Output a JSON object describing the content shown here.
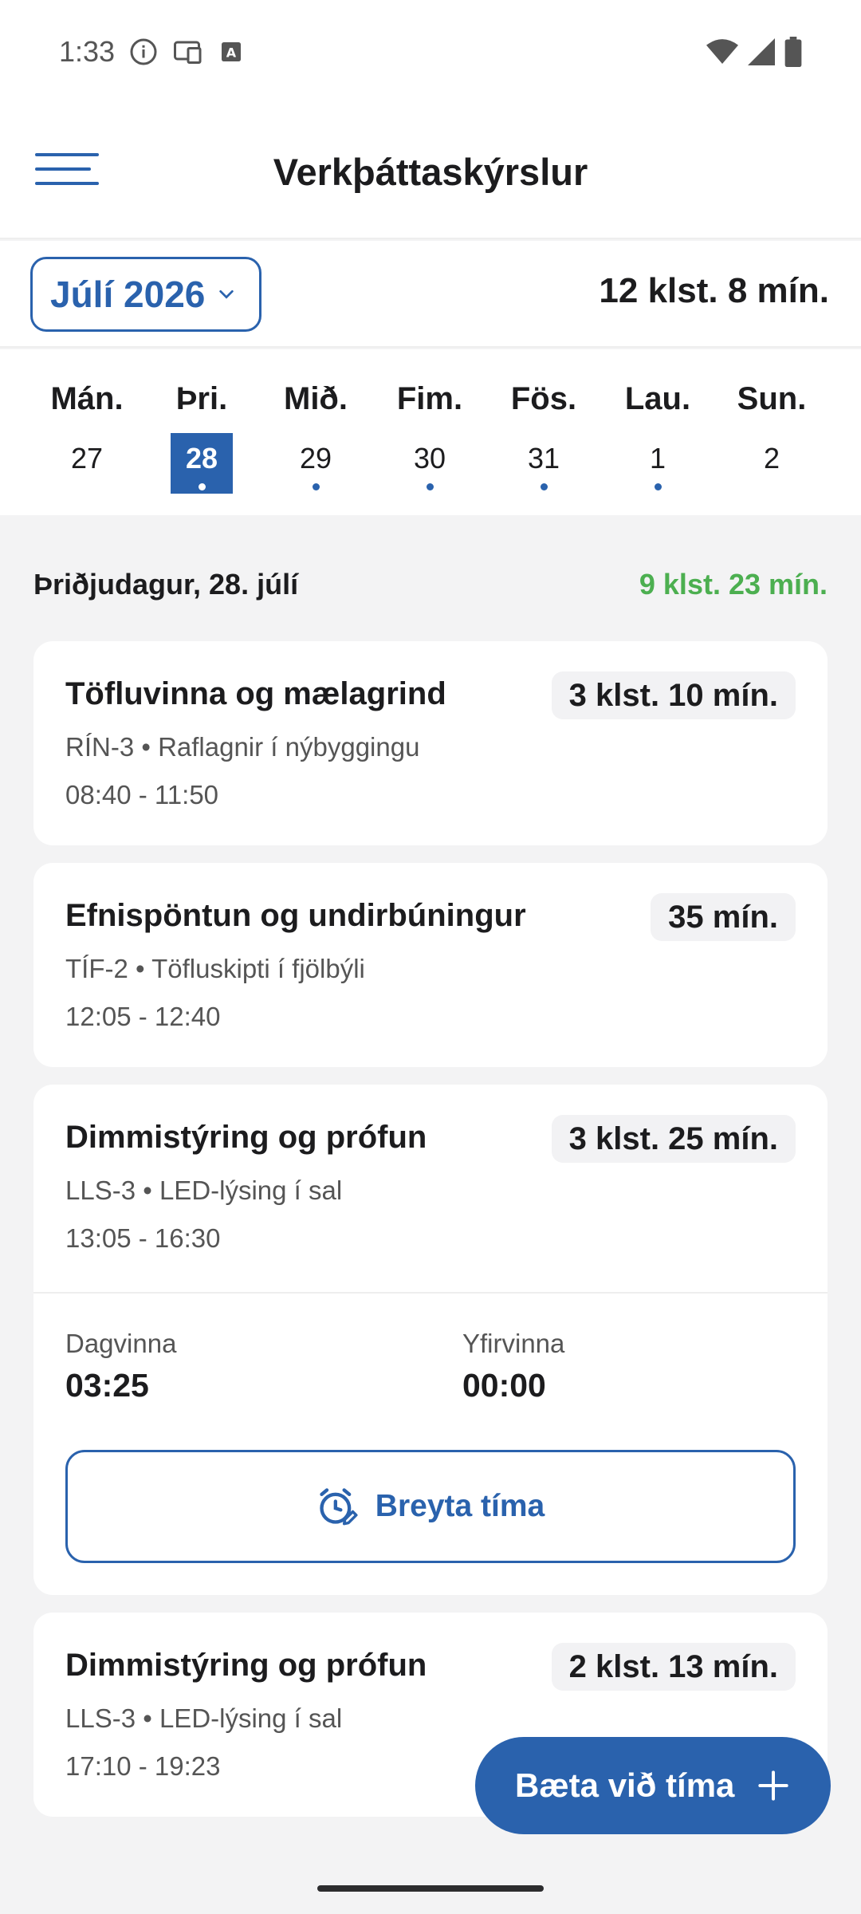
{
  "status_bar": {
    "time": "1:33",
    "icons": [
      "info-icon",
      "cast-icon",
      "text-icon",
      "wifi-icon",
      "signal-icon",
      "battery-icon"
    ]
  },
  "app_bar": {
    "title": "Verkþáttaskýrslur"
  },
  "month_bar": {
    "month_label": "Júlí 2026",
    "total": "12 klst. 8 mín."
  },
  "week": {
    "days": [
      {
        "name": "Mán.",
        "num": "27",
        "dot": false,
        "selected": false
      },
      {
        "name": "Þri.",
        "num": "28",
        "dot": true,
        "selected": true
      },
      {
        "name": "Mið.",
        "num": "29",
        "dot": true,
        "selected": false
      },
      {
        "name": "Fim.",
        "num": "30",
        "dot": true,
        "selected": false
      },
      {
        "name": "Fös.",
        "num": "31",
        "dot": true,
        "selected": false
      },
      {
        "name": "Lau.",
        "num": "1",
        "dot": true,
        "selected": false
      },
      {
        "name": "Sun.",
        "num": "2",
        "dot": false,
        "selected": false
      }
    ]
  },
  "day_header": {
    "date": "Þriðjudagur, 28. júlí",
    "total": "9 klst. 23 mín."
  },
  "entries": [
    {
      "title": "Töfluvinna og mælagrind",
      "duration": "3 klst. 10 mín.",
      "subtitle": "RÍN-3 • Raflagnir í nýbyggingu",
      "time": "08:40 - 11:50"
    },
    {
      "title": "Efnispöntun og undirbúningur",
      "duration": "35 mín.",
      "subtitle": "TÍF-2 • Töfluskipti í fjölbýli",
      "time": "12:05 - 12:40"
    },
    {
      "title": "Dimmistýring og prófun",
      "duration": "3 klst. 25 mín.",
      "subtitle": "LLS-3 • LED-lýsing í sal",
      "time": "13:05 - 16:30",
      "expanded": {
        "day_label": "Dagvinna",
        "day_value": "03:25",
        "over_label": "Yfirvinna",
        "over_value": "00:00",
        "edit_label": "Breyta tíma"
      }
    },
    {
      "title": "Dimmistýring og prófun",
      "duration": "2 klst. 13 mín.",
      "subtitle": "LLS-3 • LED-lýsing í sal",
      "time": "17:10 - 19:23"
    }
  ],
  "fab": {
    "label": "Bæta við tíma"
  },
  "colors": {
    "accent": "#2a62ad",
    "positive": "#4caf50",
    "background": "#f3f3f4"
  }
}
